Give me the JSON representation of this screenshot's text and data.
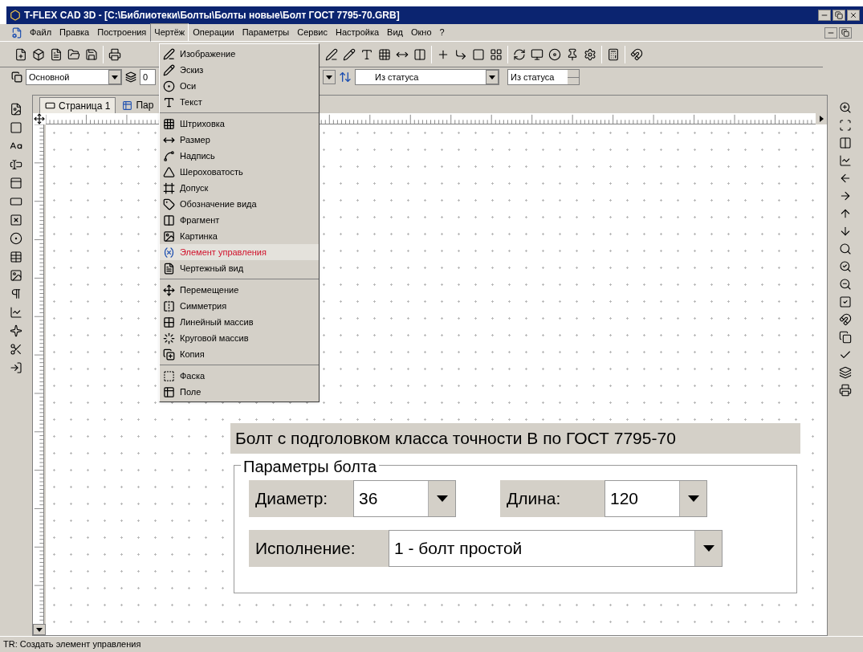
{
  "window": {
    "title": "T-FLEX CAD 3D - [C:\\Библиотеки\\Болты\\Болты новые\\Болт ГОСТ 7795-70.GRB]"
  },
  "menu_bar": [
    {
      "label": "Файл",
      "selected": false
    },
    {
      "label": "Правка",
      "selected": false
    },
    {
      "label": "Построения",
      "selected": false
    },
    {
      "label": "Чертёж",
      "selected": true
    },
    {
      "label": "Операции",
      "selected": false
    },
    {
      "label": "Параметры",
      "selected": false
    },
    {
      "label": "Сервис",
      "selected": false
    },
    {
      "label": "Настройка",
      "selected": false
    },
    {
      "label": "Вид",
      "selected": false
    },
    {
      "label": "Окно",
      "selected": false
    },
    {
      "label": "?",
      "selected": false
    }
  ],
  "open_menu": {
    "groups": [
      [
        {
          "label": "Изображение",
          "selected": false
        },
        {
          "label": "Эскиз",
          "selected": false
        },
        {
          "label": "Оси",
          "selected": false
        },
        {
          "label": "Текст",
          "selected": false
        }
      ],
      [
        {
          "label": "Штриховка",
          "selected": false
        },
        {
          "label": "Размер",
          "selected": false
        },
        {
          "label": "Надпись",
          "selected": false
        },
        {
          "label": "Шероховатость",
          "selected": false
        },
        {
          "label": "Допуск",
          "selected": false
        },
        {
          "label": "Обозначение вида",
          "selected": false
        },
        {
          "label": "Фрагмент",
          "selected": false
        },
        {
          "label": "Картинка",
          "selected": false
        },
        {
          "label": "Элемент управления",
          "selected": true
        },
        {
          "label": "Чертежный вид",
          "selected": false
        }
      ],
      [
        {
          "label": "Перемещение",
          "selected": false
        },
        {
          "label": "Симметрия",
          "selected": false
        },
        {
          "label": "Линейный массив",
          "selected": false
        },
        {
          "label": "Круговой массив",
          "selected": false
        },
        {
          "label": "Копия",
          "selected": false
        }
      ],
      [
        {
          "label": "Фаска",
          "selected": false
        },
        {
          "label": "Поле",
          "selected": false
        }
      ]
    ]
  },
  "toolbar": {
    "style_combo": "Основной",
    "layer_field": "0",
    "text_combo": "Из статуса",
    "height_spin": "Из статуса"
  },
  "page_tabs": [
    {
      "label": "Страница 1",
      "selected": true
    },
    {
      "label": "Пар",
      "selected": false
    }
  ],
  "dialog": {
    "title": "Болт с подголовком класса точности В по ГОСТ 7795-70",
    "group": "Параметры болта",
    "fields": [
      {
        "label": "Диаметр:",
        "value": "36"
      },
      {
        "label": "Длина:",
        "value": "120"
      },
      {
        "label": "Исполнение:",
        "value": "1 - болт простой"
      }
    ]
  },
  "status_bar": "TR: Создать элемент управления"
}
